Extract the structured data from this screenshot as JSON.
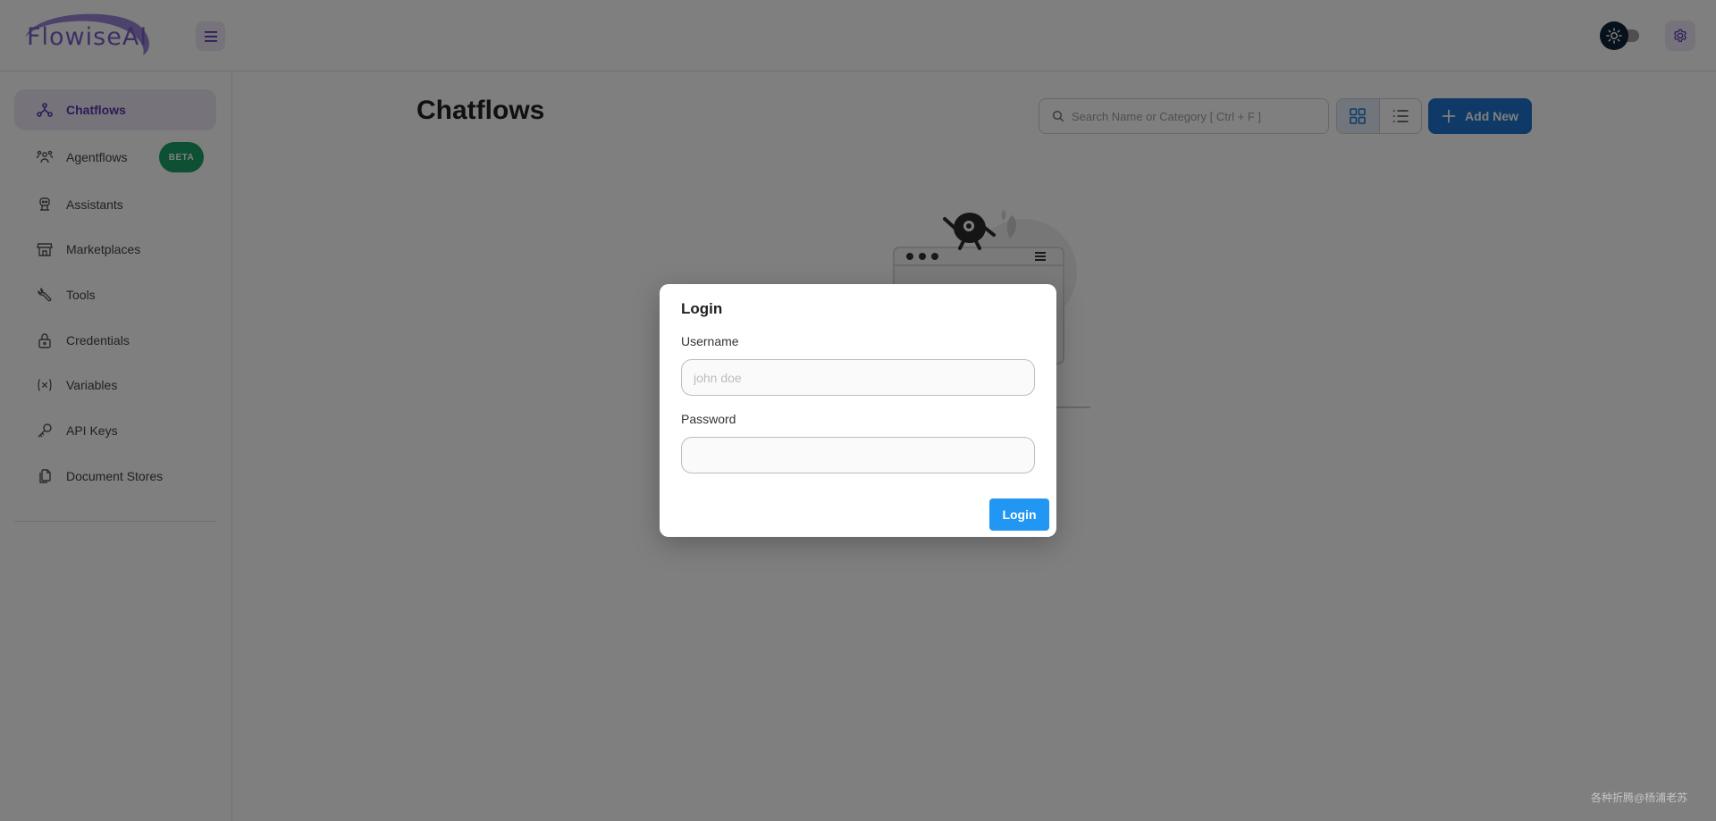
{
  "app": {
    "logo_text": "FlowiseAI"
  },
  "sidebar": {
    "items": [
      {
        "label": "Chatflows",
        "icon": "hierarchy-icon",
        "active": true
      },
      {
        "label": "Agentflows",
        "icon": "users-group-icon",
        "badge": "BETA"
      },
      {
        "label": "Assistants",
        "icon": "robot-icon"
      },
      {
        "label": "Marketplaces",
        "icon": "building-store-icon"
      },
      {
        "label": "Tools",
        "icon": "tool-icon"
      },
      {
        "label": "Credentials",
        "icon": "lock-icon"
      },
      {
        "label": "Variables",
        "icon": "variable-icon"
      },
      {
        "label": "API Keys",
        "icon": "key-icon"
      },
      {
        "label": "Document Stores",
        "icon": "files-icon"
      }
    ]
  },
  "main": {
    "title": "Chatflows",
    "search": {
      "placeholder": "Search Name or Category [ Ctrl + F ]",
      "value": ""
    },
    "add_button": "Add New"
  },
  "dialog": {
    "title": "Login",
    "username_label": "Username",
    "username_placeholder": "john doe",
    "username_value": "",
    "password_label": "Password",
    "password_value": "",
    "login_button": "Login"
  },
  "watermark": "各种折腾@杨浦老苏",
  "colors": {
    "accent": "#5e35b1",
    "primary": "#2196f3",
    "add_button": "#1f74d0",
    "badge": "#1aa067"
  }
}
